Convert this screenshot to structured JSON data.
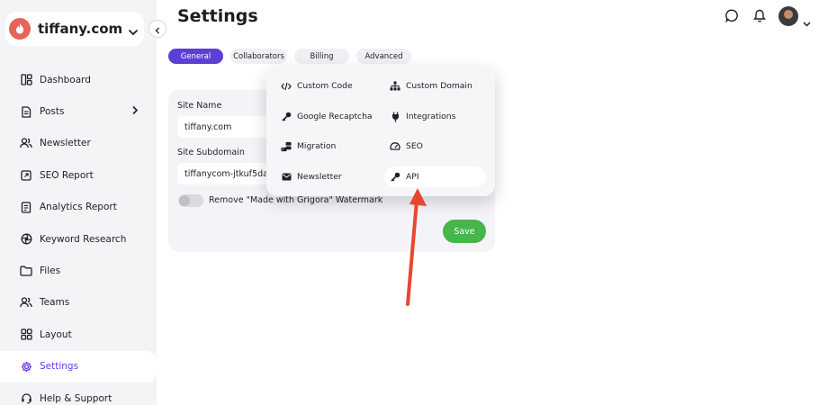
{
  "sidebar": {
    "site_name": "tiffany.com",
    "items": [
      {
        "label": "Dashboard",
        "icon": "dashboard-icon"
      },
      {
        "label": "Posts",
        "icon": "document-icon"
      },
      {
        "label": "Newsletter",
        "icon": "users-icon"
      },
      {
        "label": "SEO Report",
        "icon": "external-link-icon"
      },
      {
        "label": "Analytics Report",
        "icon": "report-icon"
      },
      {
        "label": "Keyword Research",
        "icon": "aperture-icon"
      },
      {
        "label": "Files",
        "icon": "folder-icon"
      },
      {
        "label": "Teams",
        "icon": "team-icon"
      },
      {
        "label": "Layout",
        "icon": "grid-icon"
      },
      {
        "label": "Settings",
        "icon": "gear-icon"
      },
      {
        "label": "Help & Support",
        "icon": "headset-icon"
      }
    ],
    "active": "Settings"
  },
  "header": {
    "title": "Settings"
  },
  "tabs": [
    {
      "label": "General",
      "active": true
    },
    {
      "label": "Collaborators",
      "active": false
    },
    {
      "label": "Billing",
      "active": false
    },
    {
      "label": "Advanced",
      "active": false
    }
  ],
  "form": {
    "site_name_label": "Site Name",
    "site_name_value": "tiffany.com",
    "subdomain_label": "Site Subdomain",
    "subdomain_value": "tiffanycom-jtkuf5da",
    "watermark_label": "Remove \"Made with Grigora\" Watermark",
    "watermark_enabled": false,
    "save_label": "Save"
  },
  "advanced_menu": {
    "items": [
      {
        "label": "Custom Code",
        "icon": "code-icon"
      },
      {
        "label": "Custom Domain",
        "icon": "sitemap-icon"
      },
      {
        "label": "Google Recaptcha",
        "icon": "key-icon"
      },
      {
        "label": "Integrations",
        "icon": "plug-icon"
      },
      {
        "label": "Migration",
        "icon": "database-icon"
      },
      {
        "label": "SEO",
        "icon": "gauge-icon"
      },
      {
        "label": "Newsletter",
        "icon": "envelope-icon"
      },
      {
        "label": "API",
        "icon": "key-icon"
      }
    ],
    "highlighted": "API"
  },
  "colors": {
    "accent": "#5b3fd6",
    "active_nav": "#6b37e8",
    "save": "#45b649",
    "arrow": "#e8462f"
  }
}
